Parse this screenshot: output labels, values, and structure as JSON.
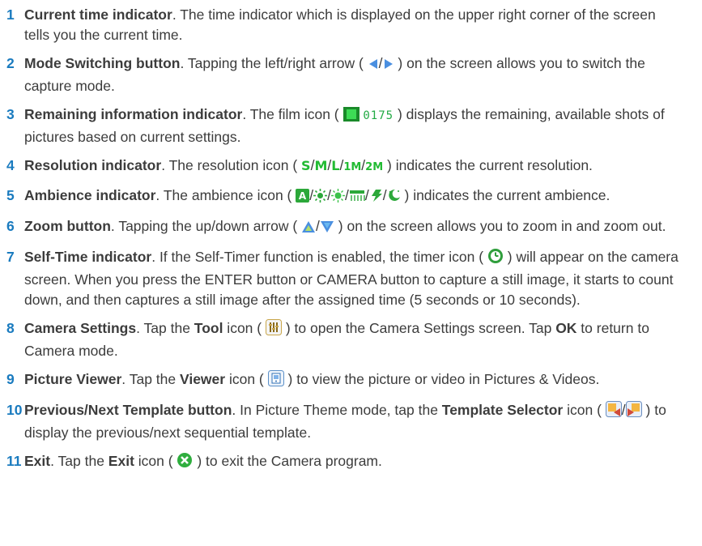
{
  "items": [
    {
      "num": "1",
      "title": "Current time indicator",
      "text": ". The time indicator which is displayed on the upper right corner of the screen tells you the current time."
    },
    {
      "num": "2",
      "title": "Mode Switching button",
      "pre": ". Tapping the left/right arrow (",
      "post": ") on the screen allows you to switch the capture mode."
    },
    {
      "num": "3",
      "title": "Remaining information indicator",
      "pre": ". The film icon (",
      "lcd": "0175",
      "post": ") displays the remaining, available shots of pictures based on current settings."
    },
    {
      "num": "4",
      "title": "Resolution indicator",
      "pre": ". The resolution icon (",
      "res": [
        "S",
        "M",
        "L",
        "1M",
        "2M"
      ],
      "post": ") indicates the current resolution."
    },
    {
      "num": "5",
      "title": "Ambience indicator",
      "pre": ". The ambience icon (",
      "post": ") indicates the current ambience."
    },
    {
      "num": "6",
      "title": "Zoom button",
      "pre": ". Tapping the up/down arrow (",
      "post": ") on the screen allows you to zoom in and zoom out."
    },
    {
      "num": "7",
      "title": "Self-Time indicator",
      "pre": ". If the Self-Timer function is enabled, the timer icon (",
      "post": ") will appear on the camera screen. When you press the ENTER button or CAMERA button to capture a still image, it starts to count down, and then captures a still image after the assigned time (5 seconds or 10 seconds)."
    },
    {
      "num": "8",
      "title": "Camera Settings",
      "p1": ". Tap the ",
      "b1": "Tool",
      "p2": " icon (",
      "p3": ") to open the Camera Settings screen. Tap ",
      "b2": "OK",
      "p4": " to return to Camera mode."
    },
    {
      "num": "9",
      "title": "Picture Viewer",
      "p1": ". Tap the ",
      "b1": "Viewer",
      "p2": " icon (",
      "p3": ") to view the picture or video in Pictures & Videos."
    },
    {
      "num": "10",
      "title": "Previous/Next Template button",
      "p1": ". In Picture Theme mode, tap the ",
      "b1": "Template Selector",
      "p2": " icon (",
      "p3": ") to display the previous/next sequential template."
    },
    {
      "num": "11",
      "title": "Exit",
      "p1": ". Tap the ",
      "b1": "Exit",
      "p2": " icon (",
      "p3": ") to exit the Camera program."
    }
  ],
  "colors": {
    "number": "#1a7bbf",
    "text": "#3c3c3c",
    "lcd_green": "#22aa44",
    "resolution_green": "#22bb33"
  },
  "icons": {
    "item2": [
      "left-arrow-icon",
      "right-arrow-icon"
    ],
    "item3": "film-icon",
    "item5": [
      "auto-ambience-icon",
      "sunny-icon",
      "bright-icon",
      "fluorescent-icon",
      "tungsten-icon",
      "night-icon"
    ],
    "item6": [
      "zoom-up-icon",
      "zoom-down-icon"
    ],
    "item7": "timer-icon",
    "item8": "tool-icon",
    "item9": "viewer-icon",
    "item10": [
      "template-prev-icon",
      "template-next-icon"
    ],
    "item11": "exit-icon"
  }
}
